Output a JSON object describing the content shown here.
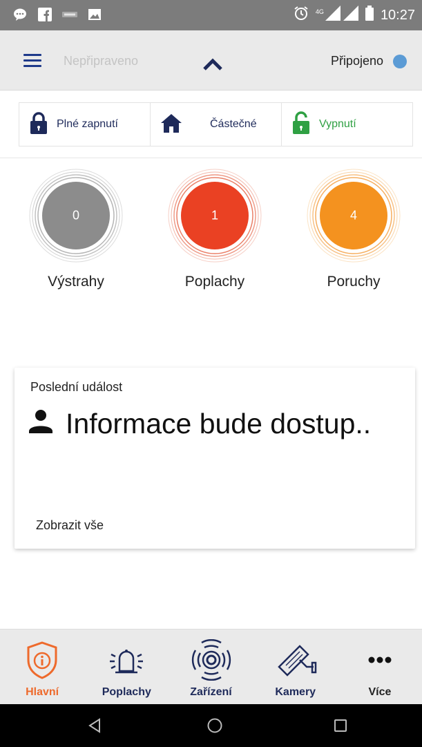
{
  "status_bar": {
    "time": "10:27",
    "network": "4G",
    "left_icons": [
      "chat-bubble-icon",
      "facebook-icon",
      "app-icon",
      "image-icon"
    ],
    "right_icons": [
      "alarm-clock-icon",
      "signal-icon",
      "battery-icon"
    ]
  },
  "header": {
    "status": "Nepřipraveno",
    "connection": "Připojeno",
    "connection_color": "#5b9bd5"
  },
  "arm_modes": {
    "full": "Plné zapnutí",
    "partial": "Částečné",
    "off": "Vypnutí"
  },
  "counters": [
    {
      "count": "0",
      "label": "Výstrahy",
      "color": "#8c8c8c"
    },
    {
      "count": "1",
      "label": "Poplachy",
      "color": "#ea4123"
    },
    {
      "count": "4",
      "label": "Poruchy",
      "color": "#f4921f"
    }
  ],
  "last_event": {
    "title": "Poslední událost",
    "info": "Informace bude dostup..",
    "view_all": "Zobrazit vše"
  },
  "bottom_nav": {
    "main": "Hlavní",
    "alarms": "Poplachy",
    "devices": "Zařízení",
    "cameras": "Kamery",
    "more": "Více"
  },
  "colors": {
    "accent_orange": "#ee6a2c",
    "navy": "#1e2a5a",
    "green": "#2fa043"
  }
}
